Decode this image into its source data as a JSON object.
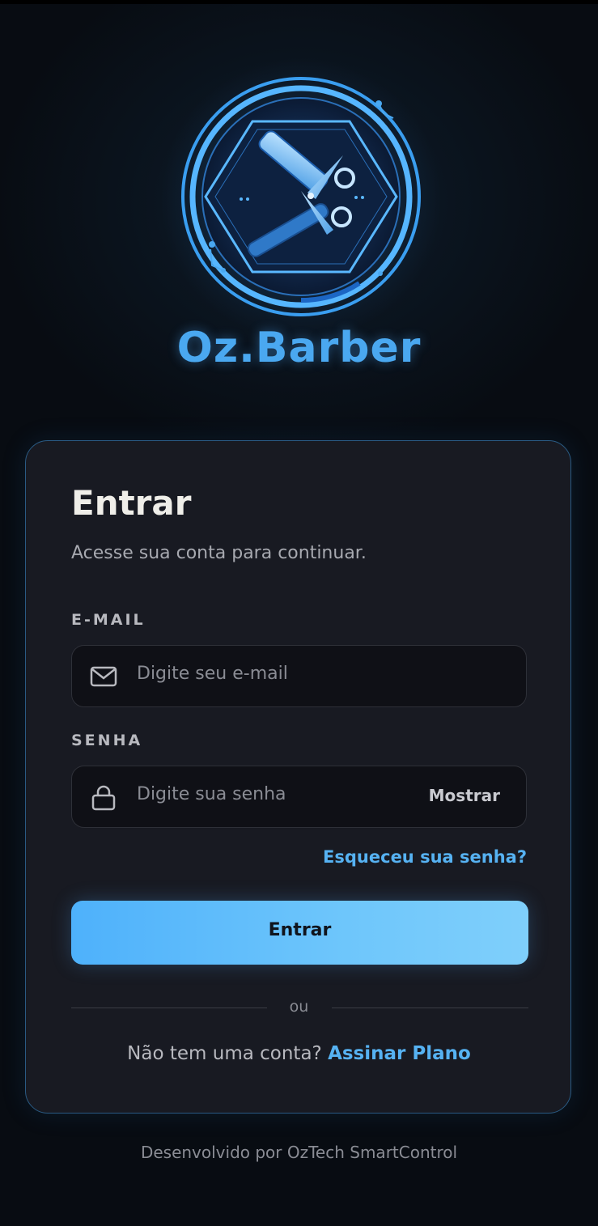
{
  "brand": {
    "name": "Oz.Barber",
    "logo_icon": "barber-scissors-razor-emblem-icon"
  },
  "login": {
    "title": "Entrar",
    "subtitle": "Acesse sua conta para continuar.",
    "email": {
      "label": "E-MAIL",
      "placeholder": "Digite seu e-mail",
      "value": "",
      "icon": "mail-icon"
    },
    "password": {
      "label": "SENHA",
      "placeholder": "Digite sua senha",
      "value": "",
      "icon": "lock-icon",
      "toggle_label": "Mostrar"
    },
    "forgot_label": "Esqueceu sua senha?",
    "submit_label": "Entrar",
    "divider_text": "ou",
    "signup_prompt": "Não tem uma conta?",
    "signup_link": "Assinar Plano"
  },
  "footer": {
    "text": "Desenvolvido por OzTech SmartControl"
  },
  "colors": {
    "accent": "#56b2f2",
    "button_gradient_start": "#4eb1fb",
    "button_gradient_end": "#7fcffb",
    "card_border": "#2a5a83",
    "card_bg": "#181a22"
  }
}
